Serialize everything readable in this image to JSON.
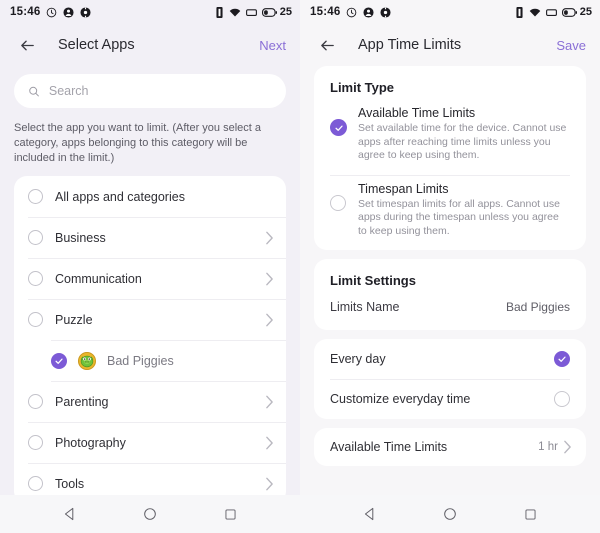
{
  "status_bar": {
    "time": "15:46",
    "battery_percent": "25",
    "left_icons": [
      "alarm-icon",
      "contact-icon",
      "notification-icon"
    ],
    "right_icons": [
      "vibrate-icon",
      "wifi-icon",
      "sim-icon",
      "battery-icon"
    ]
  },
  "accent_color": "#7C5AD6",
  "left_screen": {
    "appbar": {
      "back": "back-arrow-icon",
      "title": "Select Apps",
      "action": "Next"
    },
    "search": {
      "placeholder": "Search",
      "value": ""
    },
    "helper_text": "Select the app you want to limit. (After you select a category, apps belonging to this category will be included in the limit.)",
    "list": [
      {
        "label": "All apps and categories",
        "selected": false,
        "chevron": false,
        "type": "category"
      },
      {
        "label": "Business",
        "selected": false,
        "chevron": true,
        "type": "category"
      },
      {
        "label": "Communication",
        "selected": false,
        "chevron": true,
        "type": "category"
      },
      {
        "label": "Puzzle",
        "selected": false,
        "chevron": true,
        "type": "category"
      },
      {
        "label": "Bad Piggies",
        "selected": true,
        "chevron": false,
        "type": "app"
      },
      {
        "label": "Parenting",
        "selected": false,
        "chevron": true,
        "type": "category"
      },
      {
        "label": "Photography",
        "selected": false,
        "chevron": true,
        "type": "category"
      },
      {
        "label": "Tools",
        "selected": false,
        "chevron": true,
        "type": "category"
      }
    ]
  },
  "right_screen": {
    "appbar": {
      "back": "back-arrow-icon",
      "title": "App Time Limits",
      "action": "Save"
    },
    "limit_type": {
      "title": "Limit Type",
      "options": [
        {
          "title": "Available Time Limits",
          "desc": "Set available time for the device. Cannot use apps after reaching time limits unless you agree to keep using them.",
          "selected": true
        },
        {
          "title": "Timespan Limits",
          "desc": "Set timespan limits for all apps. Cannot use apps during the timespan unless you agree to keep using them.",
          "selected": false
        }
      ]
    },
    "limit_settings": {
      "title": "Limit Settings",
      "limits_name_key": "Limits Name",
      "limits_name_value": "Bad Piggies"
    },
    "schedule": [
      {
        "label": "Every day",
        "selected": true
      },
      {
        "label": "Customize everyday time",
        "selected": false
      }
    ],
    "available_time": {
      "label": "Available Time Limits",
      "value": "1 hr"
    }
  },
  "nav_bar": {
    "back": "nav-back-icon",
    "home": "nav-home-icon",
    "recents": "nav-recents-icon"
  }
}
